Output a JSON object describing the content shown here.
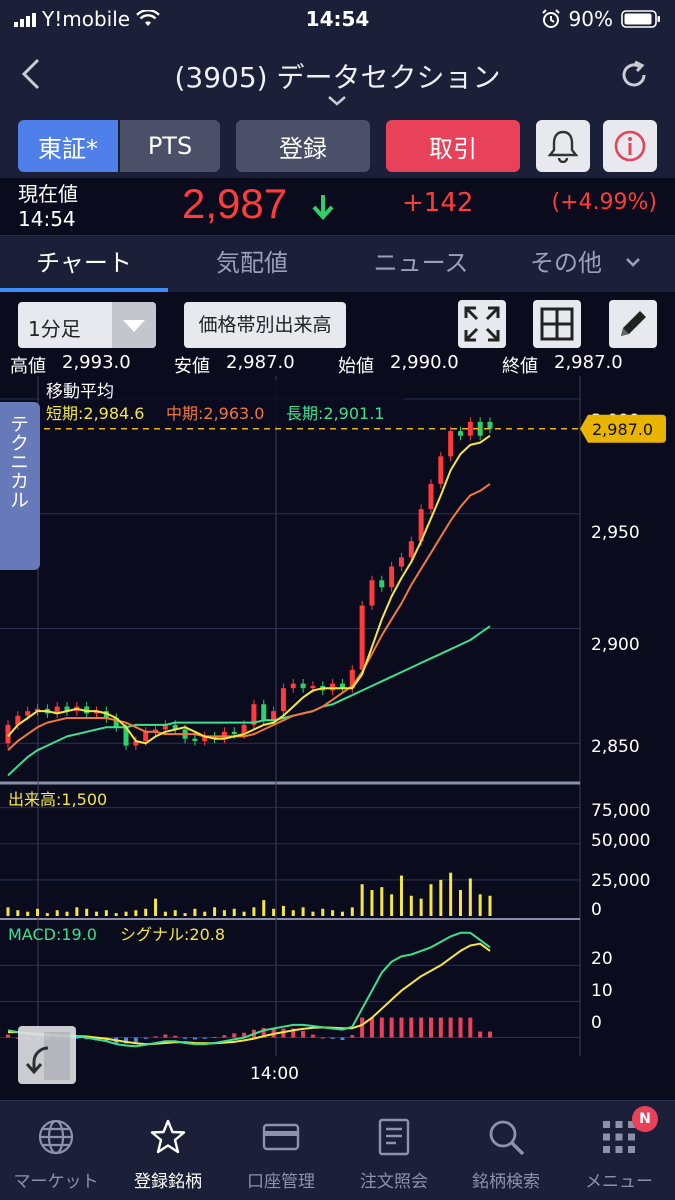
{
  "status_bar": {
    "carrier": "Y!mobile",
    "time": "14:54",
    "battery": "90%"
  },
  "nav": {
    "title": "(3905) データセクション"
  },
  "buttons": {
    "market_tse": "東証*",
    "market_pts": "PTS",
    "register": "登録",
    "trade": "取引"
  },
  "price": {
    "label_line1": "現在値",
    "label_line2": "14:54",
    "current": "2,987",
    "change": "+142",
    "change_pct": "(+4.99%)",
    "direction": "down",
    "price_color": "#ff3b3b",
    "arrow_color": "#2fd06a"
  },
  "tabs": [
    {
      "label": "チャート",
      "active": true
    },
    {
      "label": "気配値",
      "active": false
    },
    {
      "label": "ニュース",
      "active": false
    },
    {
      "label": "その他",
      "active": false
    }
  ],
  "toolbar": {
    "interval": "1分足",
    "volume_by_price": "価格帯別出来高"
  },
  "ohlc": {
    "high_label": "高値",
    "high": "2,993.0",
    "low_label": "安値",
    "low": "2,987.0",
    "open_label": "始値",
    "open": "2,990.0",
    "close_label": "終値",
    "close": "2,987.0"
  },
  "tech_tab_label": "テクニカル",
  "chart_data": {
    "type": "line",
    "x_tick_labels": [
      "14:00"
    ],
    "price_panel": {
      "legend_title": "移動平均",
      "ma_short_label": "短期:2,984.6",
      "ma_mid_label": "中期:2,963.0",
      "ma_long_label": "長期:2,901.1",
      "current_price_label": "2,987.0",
      "current_price": 2987,
      "y_ticks": [
        3000,
        2950,
        2900,
        2850
      ],
      "y_tick_labels": [
        "3,000",
        "2,950",
        "2,900",
        "2,850"
      ],
      "ylim": [
        2834,
        3010
      ],
      "colors": {
        "short": "#f5e642",
        "mid": "#f0783c",
        "long": "#3de08f",
        "up": "#ff3b3b",
        "down": "#2fd06a",
        "last": "#e8b400"
      },
      "ma_short": [
        2853,
        2858,
        2861,
        2864,
        2864,
        2863,
        2864,
        2865,
        2864,
        2864,
        2863,
        2861,
        2857,
        2851,
        2850,
        2853,
        2855,
        2856,
        2857,
        2855,
        2853,
        2852,
        2852,
        2853,
        2854,
        2856,
        2858,
        2859,
        2862,
        2866,
        2870,
        2873,
        2874,
        2874,
        2874,
        2874,
        2880,
        2892,
        2904,
        2914,
        2922,
        2929,
        2938,
        2948,
        2958,
        2969,
        2976,
        2980,
        2981,
        2984
      ],
      "ma_mid": [
        2847,
        2851,
        2854,
        2857,
        2859,
        2860,
        2861,
        2861,
        2861,
        2861,
        2861,
        2860,
        2859,
        2857,
        2855,
        2855,
        2854,
        2854,
        2854,
        2854,
        2853,
        2853,
        2853,
        2853,
        2853,
        2854,
        2856,
        2858,
        2860,
        2862,
        2863,
        2864,
        2866,
        2869,
        2872,
        2875,
        2881,
        2889,
        2897,
        2904,
        2911,
        2919,
        2926,
        2933,
        2940,
        2947,
        2953,
        2958,
        2960,
        2963
      ],
      "ma_long": [
        2836,
        2840,
        2844,
        2847,
        2849,
        2851,
        2853,
        2854,
        2855,
        2856,
        2857,
        2857,
        2857,
        2858,
        2858,
        2858,
        2858,
        2859,
        2859,
        2859,
        2859,
        2859,
        2859,
        2859,
        2859,
        2859,
        2860,
        2860,
        2861,
        2862,
        2863,
        2864,
        2866,
        2867,
        2869,
        2871,
        2873,
        2875,
        2877,
        2879,
        2881,
        2883,
        2885,
        2887,
        2889,
        2891,
        2893,
        2895,
        2898,
        2901
      ],
      "candles": [
        {
          "o": 2850,
          "c": 2858
        },
        {
          "o": 2858,
          "c": 2862
        },
        {
          "o": 2862,
          "c": 2864
        },
        {
          "o": 2864,
          "c": 2865
        },
        {
          "o": 2865,
          "c": 2863
        },
        {
          "o": 2863,
          "c": 2866
        },
        {
          "o": 2866,
          "c": 2864
        },
        {
          "o": 2864,
          "c": 2866
        },
        {
          "o": 2866,
          "c": 2863
        },
        {
          "o": 2863,
          "c": 2864
        },
        {
          "o": 2864,
          "c": 2861
        },
        {
          "o": 2861,
          "c": 2857
        },
        {
          "o": 2857,
          "c": 2849
        },
        {
          "o": 2849,
          "c": 2851
        },
        {
          "o": 2851,
          "c": 2855
        },
        {
          "o": 2855,
          "c": 2856
        },
        {
          "o": 2856,
          "c": 2858
        },
        {
          "o": 2858,
          "c": 2856
        },
        {
          "o": 2856,
          "c": 2852
        },
        {
          "o": 2852,
          "c": 2851
        },
        {
          "o": 2851,
          "c": 2853
        },
        {
          "o": 2853,
          "c": 2852
        },
        {
          "o": 2852,
          "c": 2855
        },
        {
          "o": 2855,
          "c": 2854
        },
        {
          "o": 2854,
          "c": 2858
        },
        {
          "o": 2858,
          "c": 2867
        },
        {
          "o": 2867,
          "c": 2860
        },
        {
          "o": 2860,
          "c": 2864
        },
        {
          "o": 2864,
          "c": 2874
        },
        {
          "o": 2874,
          "c": 2876
        },
        {
          "o": 2876,
          "c": 2874
        },
        {
          "o": 2874,
          "c": 2875
        },
        {
          "o": 2875,
          "c": 2873
        },
        {
          "o": 2873,
          "c": 2876
        },
        {
          "o": 2876,
          "c": 2874
        },
        {
          "o": 2874,
          "c": 2882
        },
        {
          "o": 2882,
          "c": 2910
        },
        {
          "o": 2910,
          "c": 2921
        },
        {
          "o": 2921,
          "c": 2918
        },
        {
          "o": 2918,
          "c": 2927
        },
        {
          "o": 2927,
          "c": 2931
        },
        {
          "o": 2931,
          "c": 2938
        },
        {
          "o": 2938,
          "c": 2952
        },
        {
          "o": 2952,
          "c": 2963
        },
        {
          "o": 2963,
          "c": 2975
        },
        {
          "o": 2975,
          "c": 2986
        },
        {
          "o": 2986,
          "c": 2984
        },
        {
          "o": 2984,
          "c": 2990
        },
        {
          "o": 2990,
          "c": 2984
        },
        {
          "o": 2990,
          "c": 2987
        }
      ]
    },
    "volume_panel": {
      "label": "出来高:1,500",
      "y_tick_labels": [
        "75,000",
        "50,000",
        "25,000",
        "0"
      ],
      "ylim": [
        0,
        90000
      ],
      "values": [
        6000,
        4000,
        3000,
        5000,
        2000,
        4000,
        3000,
        6000,
        5000,
        3000,
        4000,
        2000,
        3000,
        4000,
        5000,
        12000,
        3000,
        4000,
        2000,
        5000,
        3000,
        6000,
        4000,
        5000,
        3000,
        6000,
        11000,
        5000,
        7000,
        4000,
        6000,
        3000,
        5000,
        4000,
        3000,
        6000,
        22000,
        18000,
        20000,
        15000,
        28000,
        14000,
        12000,
        22000,
        25000,
        30000,
        18000,
        26000,
        15000,
        14000
      ]
    },
    "macd_panel": {
      "macd_label": "MACD:19.0",
      "signal_label": "シグナル:20.8",
      "y_tick_labels": [
        "20",
        "10",
        "0"
      ],
      "ylim": [
        -4,
        32
      ],
      "macd_color": "#3de08f",
      "signal_color": "#f5e642",
      "macd": [
        2,
        1.5,
        1,
        0.8,
        0.5,
        0.5,
        0.5,
        0.2,
        0,
        -0.5,
        -1,
        -1.8,
        -2.2,
        -2.4,
        -2,
        -1.5,
        -1,
        -1,
        -1.5,
        -1.8,
        -1.8,
        -1.5,
        -1,
        -0.5,
        0,
        1,
        2,
        2.5,
        3,
        3.5,
        3.5,
        3.2,
        2.8,
        2.5,
        2.2,
        3,
        8,
        13,
        18,
        21,
        22.5,
        23,
        24,
        25,
        26.5,
        28,
        29,
        29,
        27,
        25
      ],
      "signal": [
        1.5,
        1.5,
        1.2,
        1,
        0.8,
        0.6,
        0.5,
        0.4,
        0.3,
        0,
        -0.3,
        -0.8,
        -1.2,
        -1.6,
        -1.8,
        -1.7,
        -1.5,
        -1.3,
        -1.3,
        -1.5,
        -1.6,
        -1.6,
        -1.4,
        -1.2,
        -0.8,
        -0.3,
        0.4,
        1,
        1.5,
        2,
        2.4,
        2.7,
        2.8,
        2.7,
        2.6,
        2.6,
        3.5,
        5.5,
        8,
        10.5,
        13,
        15,
        17,
        18.5,
        20,
        22,
        24,
        25.5,
        26,
        24
      ]
    }
  },
  "bottom_tabs": [
    {
      "label": "マーケット",
      "icon": "globe-icon",
      "active": false
    },
    {
      "label": "登録銘柄",
      "icon": "star-icon",
      "active": true
    },
    {
      "label": "口座管理",
      "icon": "card-icon",
      "active": false
    },
    {
      "label": "注文照会",
      "icon": "document-icon",
      "active": false
    },
    {
      "label": "銘柄検索",
      "icon": "search-icon",
      "active": false
    },
    {
      "label": "メニュー",
      "icon": "grid-menu-icon",
      "active": false
    }
  ],
  "menu_badge": "N"
}
